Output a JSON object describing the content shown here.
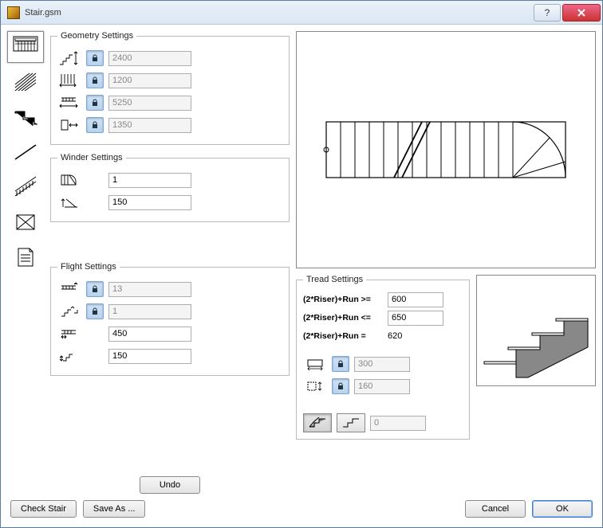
{
  "window": {
    "title": "Stair.gsm"
  },
  "sidebar": {
    "items": [
      {
        "name": "geometry-tab"
      },
      {
        "name": "structure-tab"
      },
      {
        "name": "tread-tab"
      },
      {
        "name": "riser-tab"
      },
      {
        "name": "railing-tab"
      },
      {
        "name": "landing-tab"
      },
      {
        "name": "listing-tab"
      }
    ]
  },
  "geometry": {
    "legend": "Geometry Settings",
    "height": "2400",
    "width": "1200",
    "length": "5250",
    "landing": "1350"
  },
  "winder": {
    "legend": "Winder Settings",
    "count": "1",
    "offset": "150"
  },
  "flight": {
    "legend": "Flight Settings",
    "risers": "13",
    "flights": "1",
    "going": "450",
    "rise": "150"
  },
  "tread": {
    "legend": "Tread Settings",
    "rule_ge_label": "(2*Riser)+Run >=",
    "rule_ge_val": "600",
    "rule_le_label": "(2*Riser)+Run <=",
    "rule_le_val": "650",
    "rule_eq_label": "(2*Riser)+Run  =",
    "rule_eq_val": "620",
    "run": "300",
    "riser": "160",
    "nosing": "0"
  },
  "buttons": {
    "undo": "Undo",
    "check": "Check Stair",
    "saveas": "Save As ...",
    "cancel": "Cancel",
    "ok": "OK"
  }
}
